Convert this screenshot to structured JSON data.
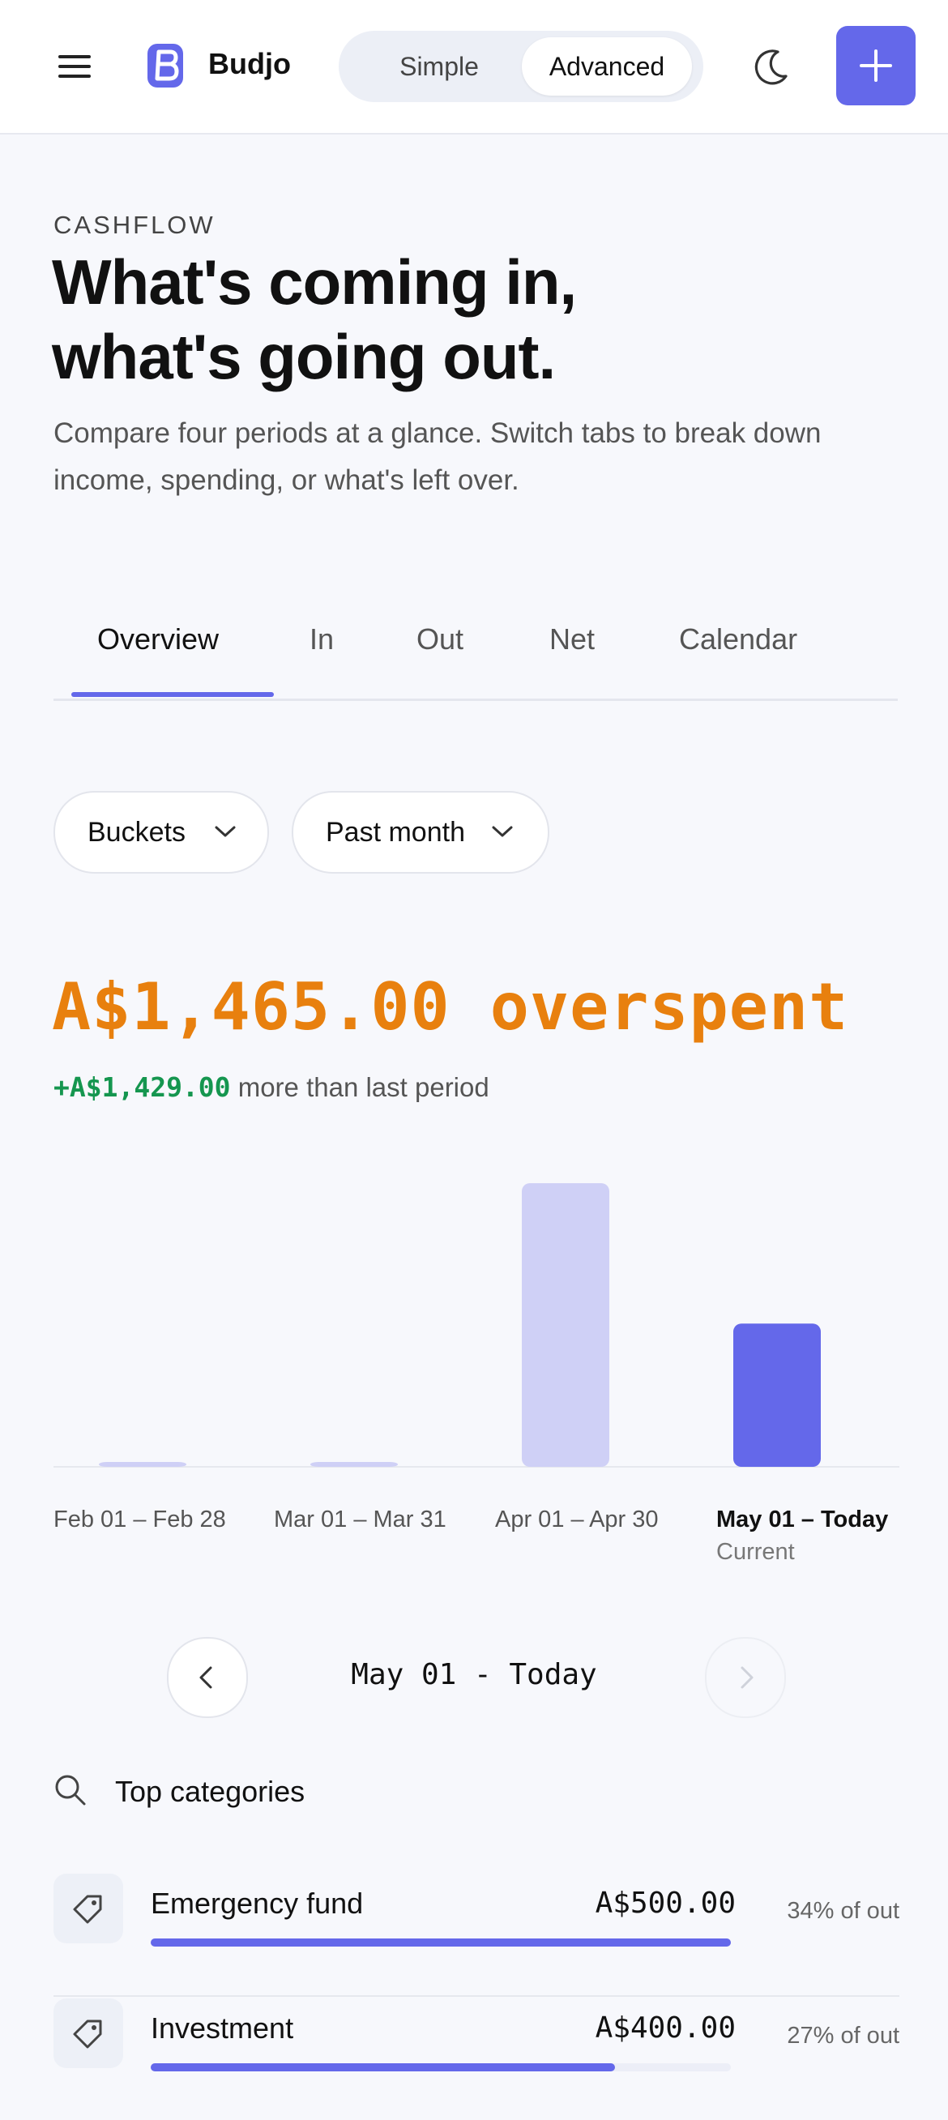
{
  "header": {
    "brand": "Budjo",
    "mode_options": [
      "Simple",
      "Advanced"
    ],
    "active_mode": "Advanced",
    "accent_color": "#6468ea",
    "icons": {
      "menu": "hamburger-icon",
      "theme": "moon-icon",
      "add": "plus-icon"
    }
  },
  "hero": {
    "eyebrow": "CASHFLOW",
    "headline_line1": "What's coming in,",
    "headline_line2": "what's going out.",
    "subtitle": "Compare four periods at a glance. Switch tabs to break down income, spending, or what's left over."
  },
  "tabs": [
    {
      "label": "Overview",
      "active": true
    },
    {
      "label": "In",
      "active": false
    },
    {
      "label": "Out",
      "active": false
    },
    {
      "label": "Net",
      "active": false
    },
    {
      "label": "Calendar",
      "active": false
    }
  ],
  "filters": {
    "grouping": "Buckets",
    "range": "Past month"
  },
  "summary": {
    "amount_text": "A$1,465.00 overspent",
    "amount_color": "#e8800e",
    "delta_value": "+A$1,429.00",
    "delta_suffix": "more than last period",
    "delta_color": "#15964f"
  },
  "chart_data": {
    "type": "bar",
    "categories": [
      "Feb 01 – Feb 28",
      "Mar 01 – Mar 31",
      "Apr 01 – Apr 30",
      "May 01 – Today"
    ],
    "current_index": 3,
    "current_sub_label": "Current",
    "values": [
      20,
      20,
      1465,
      740
    ],
    "ylim": [
      0,
      1465
    ],
    "bar_color": "#cfd0f6",
    "current_bar_color": "#6468ea",
    "grid": false
  },
  "period_nav": {
    "label": "May 01 - Today",
    "prev_enabled": true,
    "next_enabled": false
  },
  "top_categories": {
    "title": "Top categories",
    "items": [
      {
        "name": "Emergency fund",
        "amount": "A$500.00",
        "percent_label": "34% of out",
        "share": 1.0,
        "icon": "tag-icon"
      },
      {
        "name": "Investment",
        "amount": "A$400.00",
        "percent_label": "27% of out",
        "share": 0.8,
        "icon": "tag-icon"
      }
    ]
  }
}
